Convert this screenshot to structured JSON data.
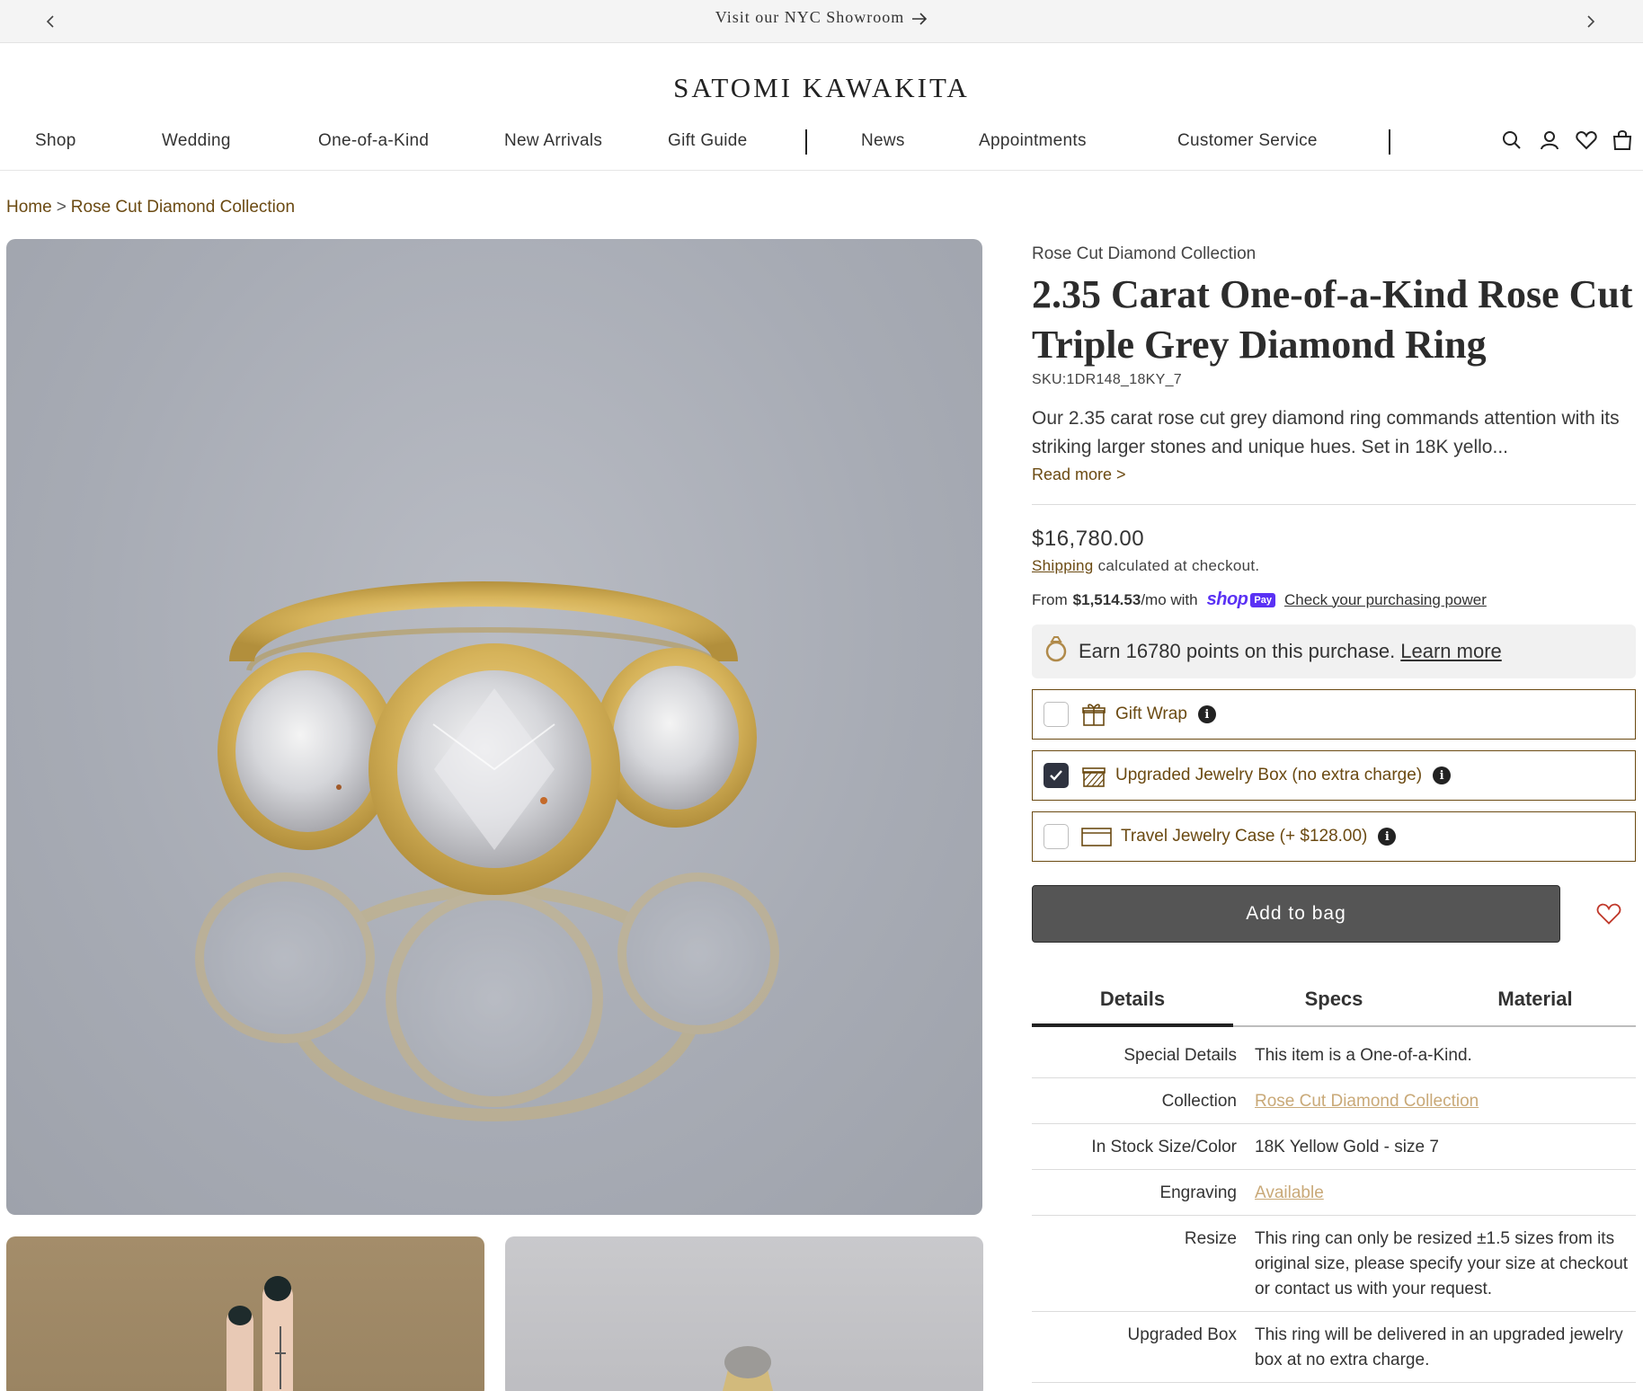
{
  "announcement": {
    "text": "Visit our NYC Showroom"
  },
  "brand": {
    "logo": "SATOMI KAWAKITA"
  },
  "nav": {
    "items": [
      "Shop",
      "Wedding",
      "One-of-a-Kind",
      "New Arrivals",
      "Gift Guide",
      "News",
      "Appointments",
      "Customer Service"
    ]
  },
  "breadcrumb": {
    "home": "Home",
    "separator": ">",
    "current": "Rose Cut Diamond Collection"
  },
  "product": {
    "collection": "Rose Cut Diamond Collection",
    "title_line1": "2.35 Carat One-of-a-Kind Rose Cut",
    "title_line2": "Triple Grey Diamond Ring",
    "sku": "SKU:1DR148_18KY_7",
    "description": "Our 2.35 carat rose cut grey diamond ring commands attention with its striking larger stones and unique hues. Set in 18K yello...",
    "read_more": "Read more >",
    "price": "$16,780.00",
    "shipping_link": "Shipping",
    "shipping_text": "calculated at checkout.",
    "installment_prefix": "From",
    "installment_amount": "$1,514.53",
    "installment_suffix": "/mo with",
    "shop_word": "shop",
    "pay_badge": "Pay",
    "installment_link": "Check your purchasing power",
    "points_text": "Earn 16780 points on this purchase.",
    "points_link": "Learn more"
  },
  "options": [
    {
      "label": "Gift Wrap",
      "checked": false,
      "icon": "gift-icon"
    },
    {
      "label": "Upgraded Jewelry Box (no extra charge)",
      "checked": true,
      "icon": "jewelry-box-icon"
    },
    {
      "label": "Travel Jewelry Case (+ $128.00)",
      "checked": false,
      "icon": "travel-case-icon"
    }
  ],
  "info_glyph": "i",
  "cart": {
    "add_label": "Add to bag"
  },
  "tabs": [
    "Details",
    "Specs",
    "Material"
  ],
  "details": [
    {
      "key": "Special Details",
      "value": "This item is a One-of-a-Kind.",
      "link": false
    },
    {
      "key": "Collection",
      "value": "Rose Cut Diamond Collection",
      "link": true
    },
    {
      "key": "In Stock Size/Color",
      "value": "18K Yellow Gold - size 7",
      "link": false
    },
    {
      "key": "Engraving",
      "value": "Available",
      "link": true
    },
    {
      "key": "Resize",
      "value": "This ring can only be resized ±1.5 sizes from its original size, please specify your size at checkout or contact us with your request.",
      "link": false
    },
    {
      "key": "Upgraded Box",
      "value": "This ring will be delivered in an upgraded jewelry box at no extra charge.",
      "link": false
    }
  ],
  "colors": {
    "accent_brown": "#6b4a12",
    "link_tan": "#c9a978",
    "button_gray": "#555555",
    "shop_pay_purple": "#5a31f4"
  }
}
